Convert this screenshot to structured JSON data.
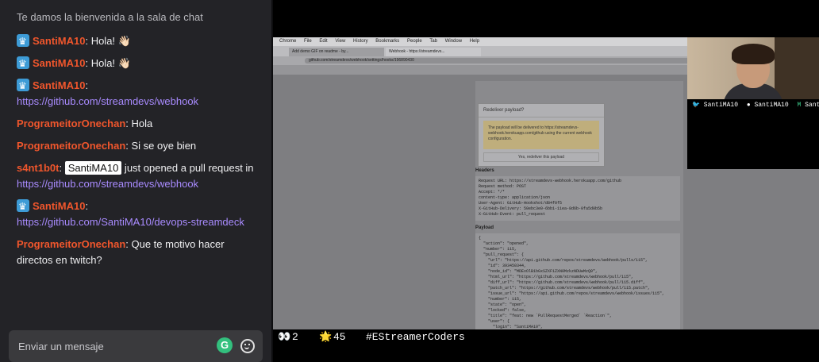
{
  "chat": {
    "welcome": "Te damos la bienvenida a la sala de chat",
    "messages": [
      {
        "user": "SantiMA10",
        "badges": true,
        "text": ": Hola! 👋🏻"
      },
      {
        "user": "SantiMA10",
        "badges": true,
        "text": ": Hola! 👋🏻"
      },
      {
        "user": "SantiMA10",
        "badges": true,
        "text": ":",
        "link": "https://github.com/streamdevs/webhook"
      },
      {
        "user": "ProgrameitorOnechan",
        "badges": false,
        "text": ": Hola"
      },
      {
        "user": "ProgrameitorOnechan",
        "badges": false,
        "text": ": Si se oye bien"
      },
      {
        "user": "s4nt1b0t",
        "badges": false,
        "text": ":",
        "mention": "SantiMA10",
        "after_mention": " just opened a pull request in",
        "link": "https://github.com/streamdevs/webhook"
      },
      {
        "user": "SantiMA10",
        "badges": true,
        "text": ":",
        "link": "https://github.com/SantiMA10/devops-streamdeck"
      },
      {
        "user": "ProgrameitorOnechan",
        "badges": false,
        "text": ": Que te motivo hacer directos en twitch?"
      }
    ],
    "input_placeholder": "Enviar un mensaje",
    "grammarly_letter": "G"
  },
  "stream": {
    "mac_menu": [
      "Chrome",
      "File",
      "Edit",
      "View",
      "History",
      "Bookmarks",
      "People",
      "Tab",
      "Window",
      "Help"
    ],
    "tabs": [
      "Add demo GIF on readme - by...",
      "Webhook - https://streamdevs..."
    ],
    "url": "github.com/streamdevs/webhook/settings/hooks/196890430",
    "headers_label": "Headers",
    "payload_label": "Payload",
    "headers_code": "Request URL: https://streamdevs-webhook.herokuapp.com/github\nRequest method: POST\nAccept: */*\ncontent-type: application/json\nUser-Agent: GitHub-Hookshot/d84f0f5\nX-GitHub-Delivery: 50ebc3e0-6bb1-11ea-8d6b-0fa5d0b5b\nX-GitHub-Event: pull_request",
    "payload_code": "{\n  \"action\": \"opened\",\n  \"number\": 115,\n  \"pull_request\": {\n    \"url\": \"https://api.github.com/repos/streamdevs/webhook/pulls/115\",\n    \"id\": 393450344,\n    \"node_id\": \"MDExOlB1bGxSZXF1ZXN0MzkzNDUwMzQ0\",\n    \"html_url\": \"https://github.com/streamdevs/webhook/pull/115\",\n    \"diff_url\": \"https://github.com/streamdevs/webhook/pull/115.diff\",\n    \"patch_url\": \"https://github.com/streamdevs/webhook/pull/115.patch\",\n    \"issue_url\": \"https://api.github.com/repos/streamdevs/webhook/issues/115\",\n    \"number\": 115,\n    \"state\": \"open\",\n    \"locked\": false,\n    \"title\": \"feat: new `PullRequestMerged` `Reaction`\",\n    \"user\": {\n      \"login\": \"SantiMA10\",",
    "modal": {
      "title": "Redeliver payload?",
      "body": "The payload will be delivered to https://streamdevs-webhook.herokuapp.com/github using the current webhook configuration.",
      "button": "Yes, redeliver this payload"
    },
    "socials": [
      {
        "icon": "twitter-icon",
        "glyph": "🐦",
        "handle": "SantiMA10"
      },
      {
        "icon": "github-icon",
        "glyph": "●",
        "handle": "SantiMA10"
      },
      {
        "icon": "dev-icon",
        "glyph": "M",
        "handle": "Santi"
      }
    ],
    "bottom_bar": {
      "eyes_count": "2",
      "coins_count": "45",
      "hashtag": "#EStreamerCoders"
    }
  },
  "colors": {
    "username": "#f0562c",
    "link": "#a98bff",
    "chat_bg": "#232327"
  }
}
